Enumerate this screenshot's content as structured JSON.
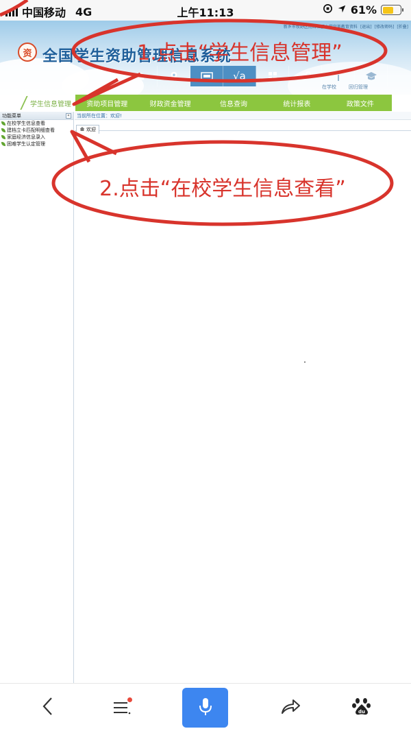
{
  "status_bar": {
    "carrier": "中国移动",
    "network": "4G",
    "time": "上午11:13",
    "battery_percent": "61%",
    "battery_level": 0.61
  },
  "header": {
    "top_info": {
      "user_text": "新乡市牧野区南辉社区小学完美教育资料",
      "logout": "[退出]",
      "change_password": "[修改密码]",
      "collect": "[折叠]"
    },
    "logo_text": "资",
    "site_title": "全国学生资助管理信息系统",
    "nav_icons": [
      "home-icon",
      "location-icon",
      "card-icon",
      "sqrt-icon",
      "grid-icon",
      "gear-icon",
      "info-icon",
      "graduation-icon"
    ],
    "nav_labels": [
      "在学校",
      "回归管理"
    ]
  },
  "menu": {
    "active": "学生信息管理",
    "items": [
      "资助项目管理",
      "财政资金管理",
      "信息查询",
      "统计报表",
      "政策文件"
    ]
  },
  "left_panel": {
    "title": "功能菜单",
    "collapse": "«",
    "items": [
      "在校学生信息查看",
      "建档立卡匹配明细查看",
      "家庭经济信息录入",
      "困难学生认定管理"
    ]
  },
  "main": {
    "breadcrumb": "当前所在位置：欢迎!",
    "tab_label": "欢迎"
  },
  "annotations": {
    "step1": "1.点击“学生信息管理”",
    "step2": "2.点击“在校学生信息查看”",
    "color": "#d8342c"
  },
  "bottom_bar": {
    "buttons": [
      "back-icon",
      "menu-icon",
      "mic-icon",
      "share-icon",
      "baidu-icon"
    ],
    "accent_color": "#3d86f0"
  }
}
